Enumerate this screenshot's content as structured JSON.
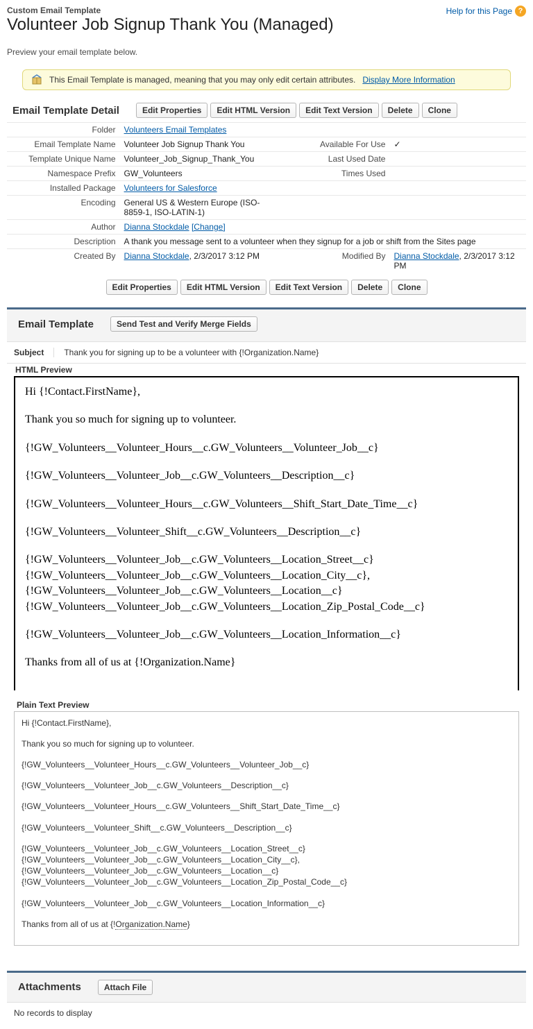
{
  "header": {
    "page_type": "Custom Email Template",
    "page_title": "Volunteer Job Signup Thank You (Managed)",
    "help_text": "Help for this Page",
    "preview_note": "Preview your email template below."
  },
  "managed_banner": {
    "text": "This Email Template is managed, meaning that you may only edit certain attributes.",
    "link": "Display More Information"
  },
  "buttons": {
    "edit_properties": "Edit Properties",
    "edit_html": "Edit HTML Version",
    "edit_text": "Edit Text Version",
    "delete": "Delete",
    "clone": "Clone",
    "send_test": "Send Test and Verify Merge Fields",
    "attach_file": "Attach File"
  },
  "section_titles": {
    "detail": "Email Template Detail",
    "template": "Email Template",
    "attachments": "Attachments"
  },
  "labels": {
    "folder": "Folder",
    "template_name": "Email Template Name",
    "available": "Available For Use",
    "unique_name": "Template Unique Name",
    "last_used": "Last Used Date",
    "namespace": "Namespace Prefix",
    "times_used": "Times Used",
    "installed_pkg": "Installed Package",
    "encoding": "Encoding",
    "author": "Author",
    "description": "Description",
    "created_by": "Created By",
    "modified_by": "Modified By",
    "subject": "Subject",
    "html_preview": "HTML Preview",
    "plain_preview": "Plain Text Preview"
  },
  "detail": {
    "folder": "Volunteers Email Templates",
    "template_name": "Volunteer Job Signup Thank You",
    "available_check": "✓",
    "unique_name": "Volunteer_Job_Signup_Thank_You",
    "last_used": "",
    "namespace": "GW_Volunteers",
    "times_used": "",
    "installed_pkg": "Volunteers for Salesforce",
    "encoding": "General US & Western Europe (ISO-8859-1, ISO-LATIN-1)",
    "author_name": "Dianna Stockdale",
    "author_change": "[Change]",
    "description": "A thank you message sent to a volunteer when they signup for a job or shift from the Sites page",
    "created_by_name": "Dianna Stockdale",
    "created_by_date": ", 2/3/2017 3:12 PM",
    "modified_by_name": "Dianna Stockdale",
    "modified_by_date": ", 2/3/2017 3:12 PM"
  },
  "subject_value": "Thank you for signing up to be a volunteer with {!Organization.Name}",
  "html_preview": {
    "greeting": "Hi {!Contact.FirstName},",
    "intro": "Thank you so much for signing up to volunteer.",
    "m1": "{!GW_Volunteers__Volunteer_Hours__c.GW_Volunteers__Volunteer_Job__c}",
    "m2": "{!GW_Volunteers__Volunteer_Job__c.GW_Volunteers__Description__c}",
    "m3": "{!GW_Volunteers__Volunteer_Hours__c.GW_Volunteers__Shift_Start_Date_Time__c}",
    "m4": "{!GW_Volunteers__Volunteer_Shift__c.GW_Volunteers__Description__c}",
    "loc1": "{!GW_Volunteers__Volunteer_Job__c.GW_Volunteers__Location_Street__c}",
    "loc2": "{!GW_Volunteers__Volunteer_Job__c.GW_Volunteers__Location_City__c},",
    "loc3": "{!GW_Volunteers__Volunteer_Job__c.GW_Volunteers__Location__c}",
    "loc4": "{!GW_Volunteers__Volunteer_Job__c.GW_Volunteers__Location_Zip_Postal_Code__c}",
    "m5": "{!GW_Volunteers__Volunteer_Job__c.GW_Volunteers__Location_Information__c}",
    "closing": "Thanks from all of us at {!Organization.Name}"
  },
  "plain_preview": {
    "greeting": "Hi {!Contact.FirstName},",
    "intro": "Thank you so much for signing up to volunteer.",
    "m1": "{!GW_Volunteers__Volunteer_Hours__c.GW_Volunteers__Volunteer_Job__c}",
    "m2": "{!GW_Volunteers__Volunteer_Job__c.GW_Volunteers__Description__c}",
    "m3": "{!GW_Volunteers__Volunteer_Hours__c.GW_Volunteers__Shift_Start_Date_Time__c}",
    "m4": "{!GW_Volunteers__Volunteer_Shift__c.GW_Volunteers__Description__c}",
    "loc1": "{!GW_Volunteers__Volunteer_Job__c.GW_Volunteers__Location_Street__c}",
    "loc2": "{!GW_Volunteers__Volunteer_Job__c.GW_Volunteers__Location_City__c},",
    "loc3": "{!GW_Volunteers__Volunteer_Job__c.GW_Volunteers__Location__c}",
    "loc4": "{!GW_Volunteers__Volunteer_Job__c.GW_Volunteers__Location_Zip_Postal_Code__c}",
    "m5": "{!GW_Volunteers__Volunteer_Job__c.GW_Volunteers__Location_Information__c}",
    "closing_prefix": "Thanks from all of us at {!",
    "closing_link": "Organization.Name",
    "closing_suffix": "}"
  },
  "attachments": {
    "empty": "No records to display"
  }
}
